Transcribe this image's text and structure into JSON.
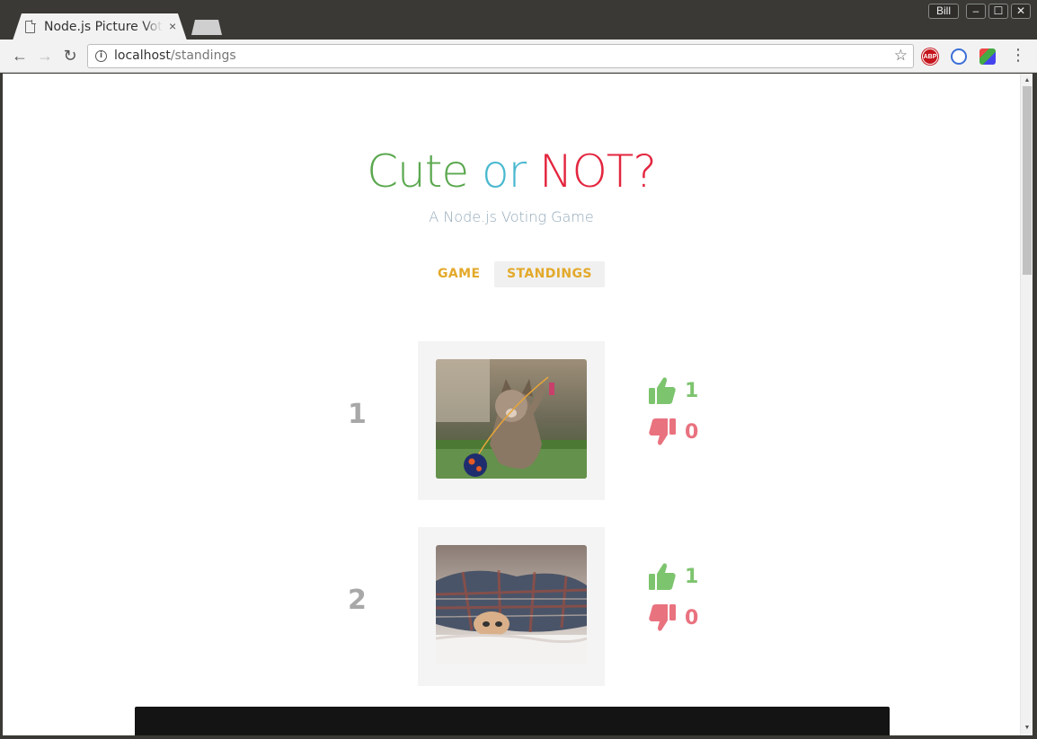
{
  "browser": {
    "tab_title": "Node.js Picture Voting Game",
    "tab_close": "×",
    "user_label": "Bill",
    "window_buttons": {
      "minimize": "–",
      "maximize": "☐",
      "close": "✕"
    },
    "url_host": "localhost",
    "url_path": "/standings",
    "extensions": [
      "adblock-plus-icon",
      "sync-icon",
      "extension-icon"
    ],
    "abp_label": "ABP"
  },
  "page": {
    "title": {
      "word1": "Cute",
      "word2": "or",
      "word3": "NOT?"
    },
    "subtitle": "A Node.js Voting Game",
    "nav": {
      "game": "GAME",
      "standings": "STANDINGS",
      "active": "standings"
    },
    "standings": [
      {
        "rank": "1",
        "image": "kitten playing with toy ball",
        "up": "1",
        "down": "0"
      },
      {
        "rank": "2",
        "image": "kitten under plaid blanket",
        "up": "1",
        "down": "0"
      }
    ]
  },
  "colors": {
    "cute": "#5ba84f",
    "or": "#49b8cf",
    "not": "#e3263f",
    "nav": "#e3a92a",
    "thumbs_up": "#7dc46e",
    "thumbs_down": "#e9727f"
  }
}
